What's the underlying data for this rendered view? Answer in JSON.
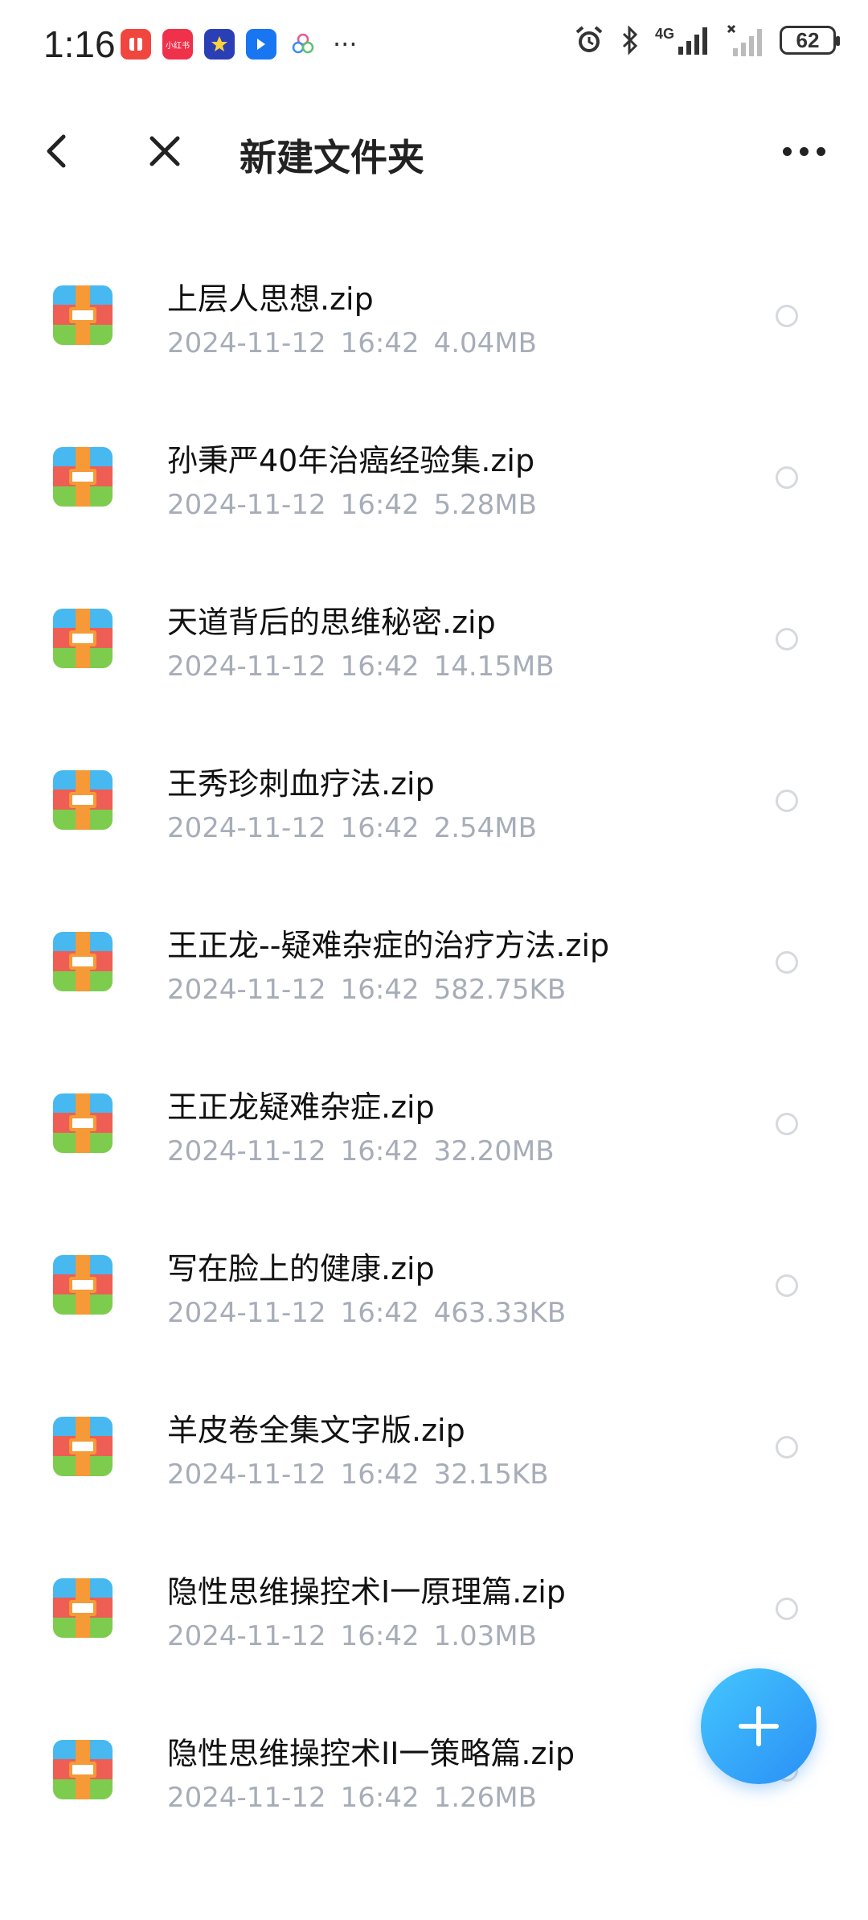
{
  "status_bar": {
    "time": "1:16",
    "app_icons": [
      {
        "name": "red-book-app-icon",
        "color": "#f0463e",
        "label": ""
      },
      {
        "name": "xiaohongshu-app-icon",
        "color": "#f0314b",
        "label": "小红书"
      },
      {
        "name": "star-app-icon",
        "color": "#2a3fb5",
        "label": ""
      },
      {
        "name": "feishu-app-icon",
        "color": "#1976f2",
        "label": ""
      },
      {
        "name": "cluster-app-icon",
        "color": "#ffffff",
        "label": ""
      }
    ],
    "more": "···",
    "network": "4G",
    "battery": "62"
  },
  "header": {
    "title": "新建文件夹"
  },
  "files": [
    {
      "name": "上层人思想.zip",
      "date": "2024-11-12",
      "time": "16:42",
      "size": "4.04MB"
    },
    {
      "name": "孙秉严40年治癌经验集.zip",
      "date": "2024-11-12",
      "time": "16:42",
      "size": "5.28MB"
    },
    {
      "name": "天道背后的思维秘密.zip",
      "date": "2024-11-12",
      "time": "16:42",
      "size": "14.15MB"
    },
    {
      "name": "王秀珍刺血疗法.zip",
      "date": "2024-11-12",
      "time": "16:42",
      "size": "2.54MB"
    },
    {
      "name": "王正龙--疑难杂症的治疗方法.zip",
      "date": "2024-11-12",
      "time": "16:42",
      "size": "582.75KB"
    },
    {
      "name": "王正龙疑难杂症.zip",
      "date": "2024-11-12",
      "time": "16:42",
      "size": "32.20MB"
    },
    {
      "name": "写在脸上的健康.zip",
      "date": "2024-11-12",
      "time": "16:42",
      "size": "463.33KB"
    },
    {
      "name": "羊皮卷全集文字版.zip",
      "date": "2024-11-12",
      "time": "16:42",
      "size": "32.15KB"
    },
    {
      "name": "隐性思维操控术I一原理篇.zip",
      "date": "2024-11-12",
      "time": "16:42",
      "size": "1.03MB"
    },
    {
      "name": "隐性思维操控术II一策略篇.zip",
      "date": "2024-11-12",
      "time": "16:42",
      "size": "1.26MB"
    }
  ],
  "colors": {
    "accent": "#2a8ff5",
    "meta_text": "#a7adb8",
    "zip_blue": "#47b8f0",
    "zip_red": "#ee5e55",
    "zip_green": "#7ecc4e",
    "zip_strap": "#f59a36"
  }
}
